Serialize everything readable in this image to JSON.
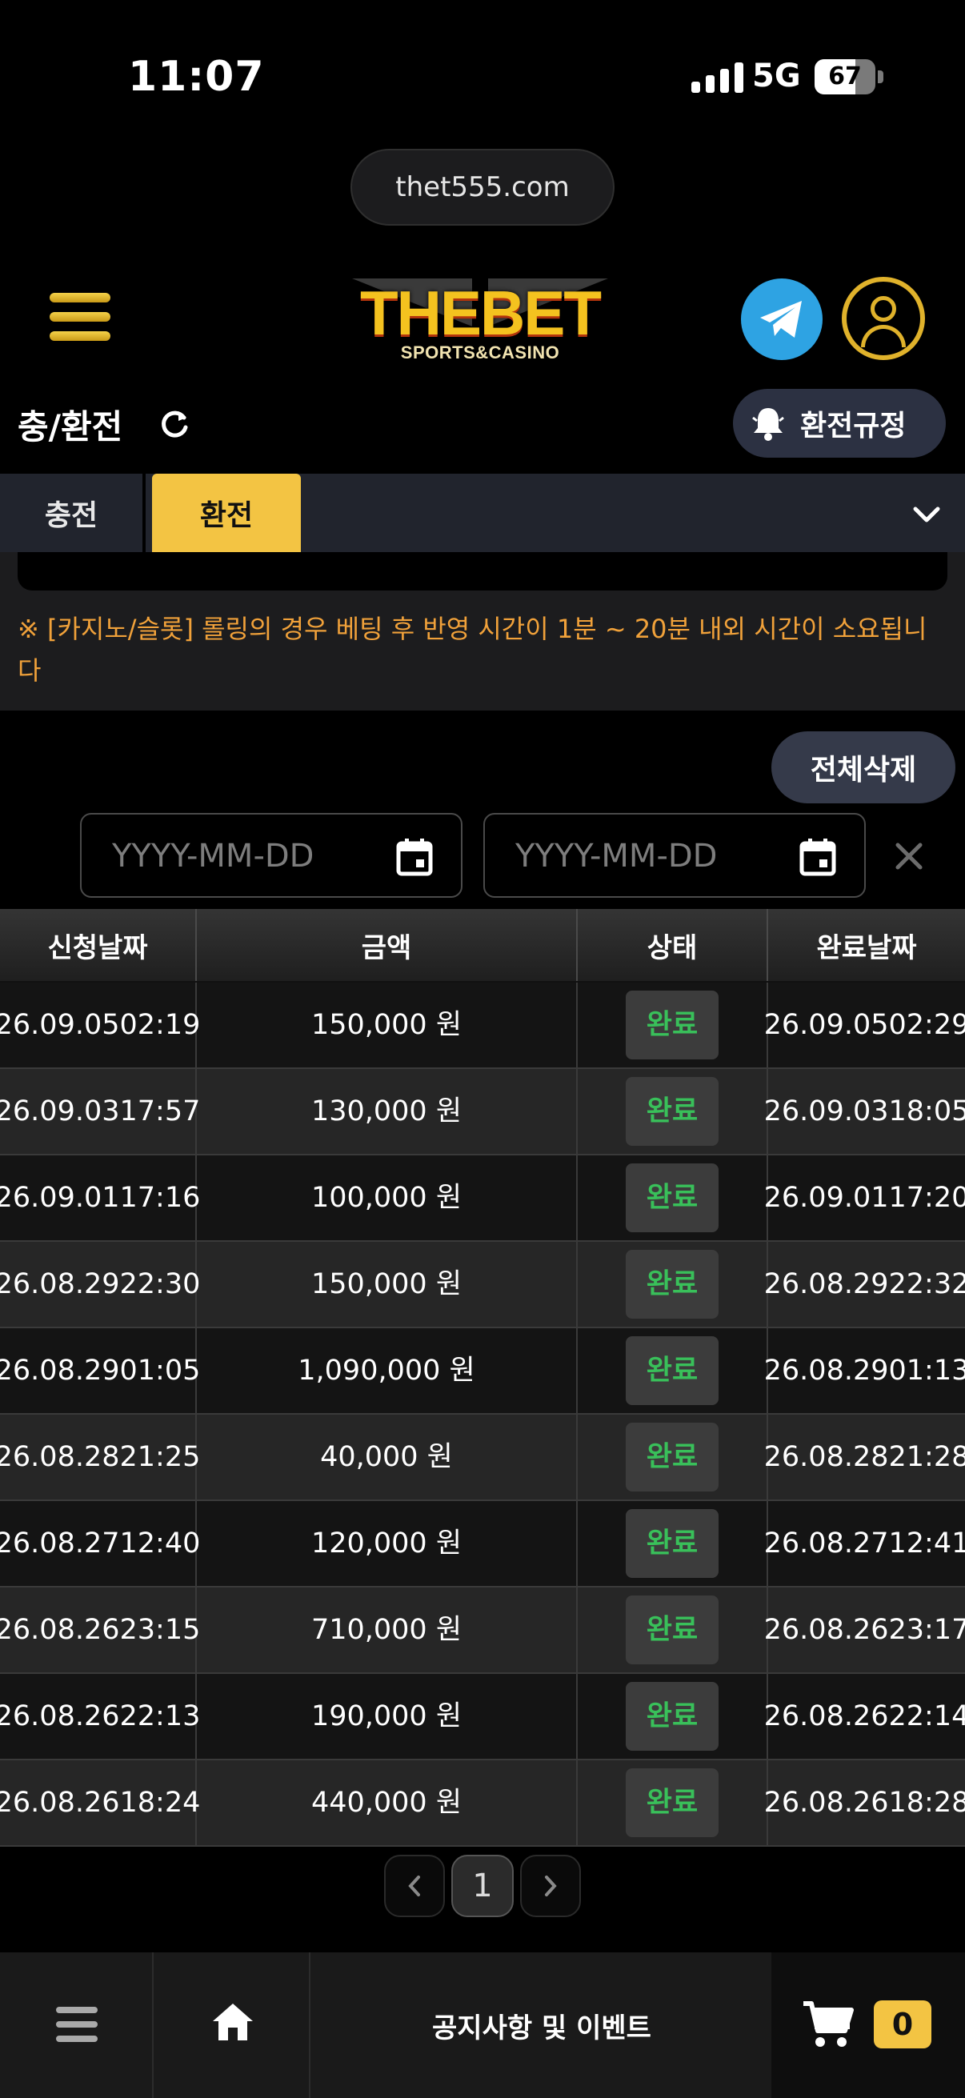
{
  "status_bar": {
    "time": "11:07",
    "network": "5G",
    "battery": "67",
    "battery_level": 0.67
  },
  "browser": {
    "url": "thet555.com"
  },
  "header": {
    "logo_text": "THEBET",
    "logo_subtext": "SPORTS&CASINO"
  },
  "page": {
    "title": "충/환전",
    "rules_button": "환전규정"
  },
  "tabs": [
    {
      "label": "충전",
      "active": false
    },
    {
      "label": "환전",
      "active": true
    }
  ],
  "notice": {
    "text": "※ [카지노/슬롯] 롤링의 경우 베팅 후 반영 시간이 1분 ~ 20분 내외 시간이 소요됩니다"
  },
  "actions": {
    "delete_all": "전체삭제"
  },
  "filters": {
    "start_placeholder": "YYYY-MM-DD",
    "end_placeholder": "YYYY-MM-DD"
  },
  "table": {
    "headers": [
      "신청날짜",
      "금액",
      "상태",
      "완료날짜"
    ],
    "rows": [
      {
        "req_date": "26.09.05",
        "req_time": "02:19",
        "amount": "150,000 원",
        "status": "완료",
        "done_date": "26.09.05",
        "done_time": "02:29"
      },
      {
        "req_date": "26.09.03",
        "req_time": "17:57",
        "amount": "130,000 원",
        "status": "완료",
        "done_date": "26.09.03",
        "done_time": "18:05"
      },
      {
        "req_date": "26.09.01",
        "req_time": "17:16",
        "amount": "100,000 원",
        "status": "완료",
        "done_date": "26.09.01",
        "done_time": "17:20"
      },
      {
        "req_date": "26.08.29",
        "req_time": "22:30",
        "amount": "150,000 원",
        "status": "완료",
        "done_date": "26.08.29",
        "done_time": "22:32"
      },
      {
        "req_date": "26.08.29",
        "req_time": "01:05",
        "amount": "1,090,000 원",
        "status": "완료",
        "done_date": "26.08.29",
        "done_time": "01:13"
      },
      {
        "req_date": "26.08.28",
        "req_time": "21:25",
        "amount": "40,000 원",
        "status": "완료",
        "done_date": "26.08.28",
        "done_time": "21:28"
      },
      {
        "req_date": "26.08.27",
        "req_time": "12:40",
        "amount": "120,000 원",
        "status": "완료",
        "done_date": "26.08.27",
        "done_time": "12:41"
      },
      {
        "req_date": "26.08.26",
        "req_time": "23:15",
        "amount": "710,000 원",
        "status": "완료",
        "done_date": "26.08.26",
        "done_time": "23:17"
      },
      {
        "req_date": "26.08.26",
        "req_time": "22:13",
        "amount": "190,000 원",
        "status": "완료",
        "done_date": "26.08.26",
        "done_time": "22:14"
      },
      {
        "req_date": "26.08.26",
        "req_time": "18:24",
        "amount": "440,000 원",
        "status": "완료",
        "done_date": "26.08.26",
        "done_time": "18:28"
      }
    ]
  },
  "pagination": {
    "current": "1"
  },
  "bottom_nav": {
    "notice_label": "공지사항 및 이벤트",
    "cart_count": "0"
  },
  "colors": {
    "accent": "#f3c443",
    "notice_text": "#f0a13a",
    "status_done": "#39c05a",
    "telegram": "#2ea3e3"
  },
  "icons": [
    "signal-icon",
    "battery-icon",
    "menu-icon",
    "telegram-icon",
    "user-icon",
    "refresh-icon",
    "bell-icon",
    "chevron-down-icon",
    "calendar-icon",
    "close-icon",
    "chevron-left-icon",
    "chevron-right-icon",
    "home-icon",
    "cart-icon"
  ]
}
